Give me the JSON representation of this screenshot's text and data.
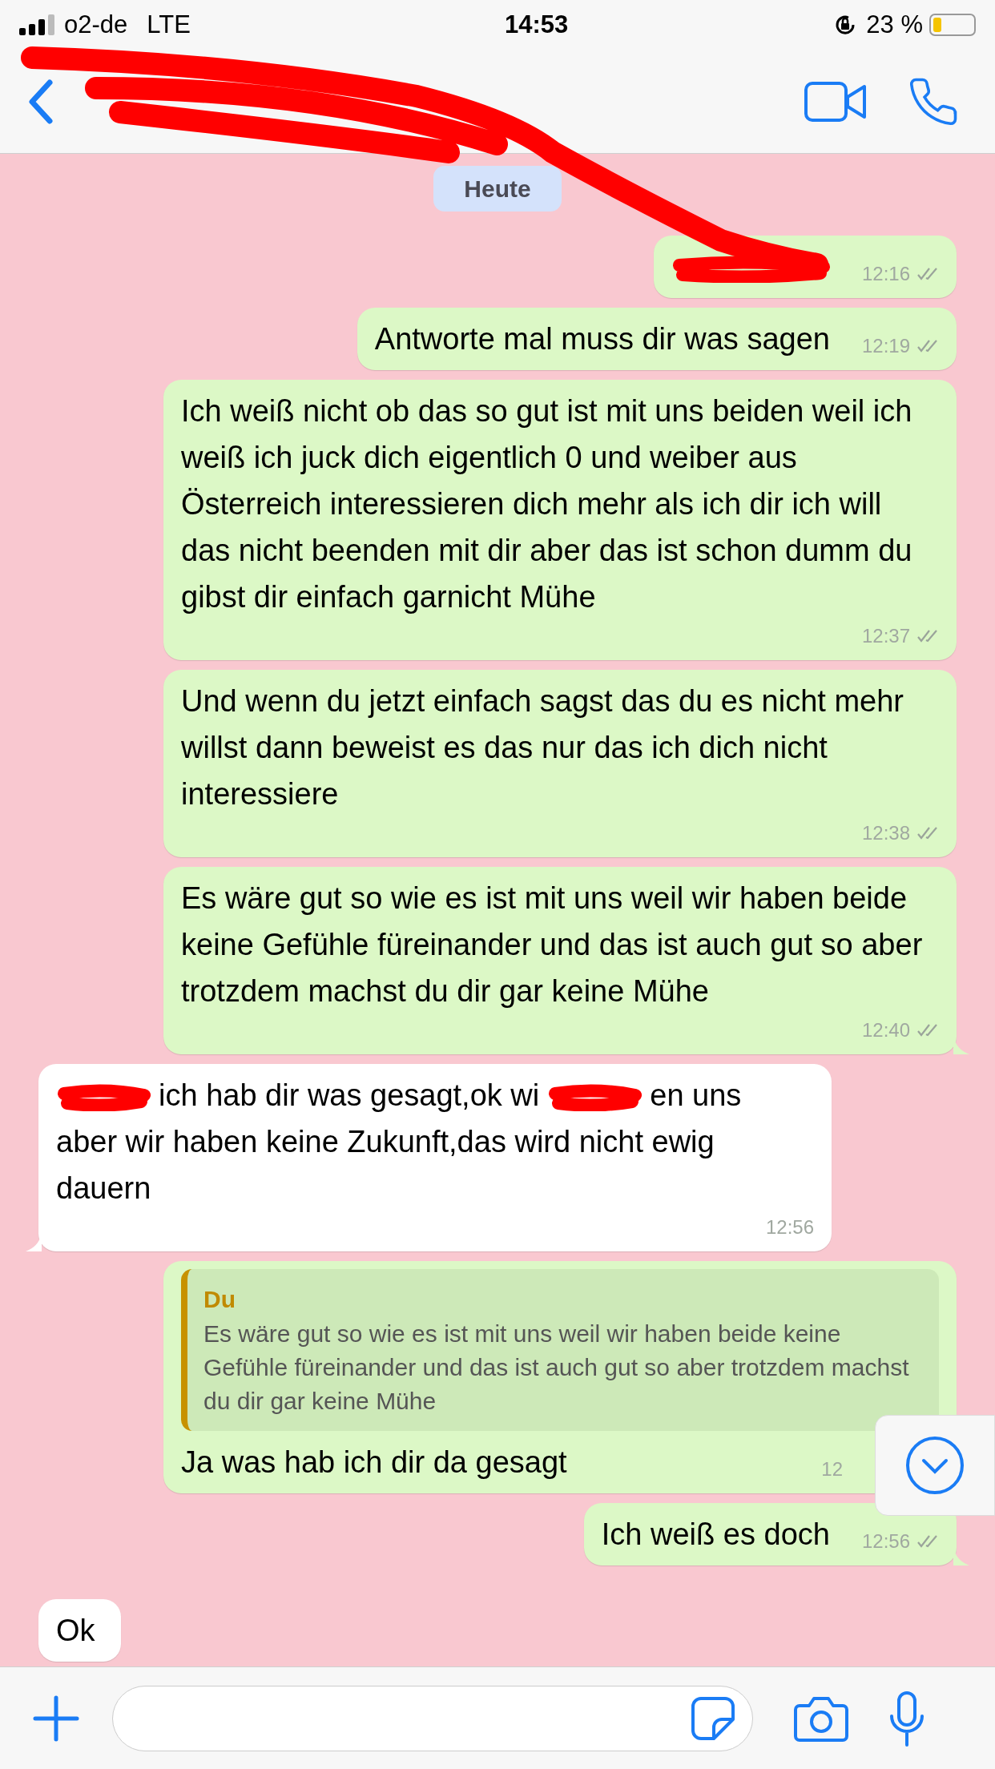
{
  "status_bar": {
    "carrier": "o2-de",
    "network": "LTE",
    "time": "14:53",
    "battery": "23 %"
  },
  "date_chip": "Heute",
  "messages": [
    {
      "kind": "outgoing",
      "parts": [
        {
          "kind": "redaction"
        }
      ],
      "time": "12:16",
      "ticks": true,
      "tail": false
    },
    {
      "kind": "outgoing",
      "parts": [
        {
          "kind": "text",
          "text": "Antworte mal muss dir was sagen"
        }
      ],
      "time": "12:19",
      "ticks": true,
      "tail": false
    },
    {
      "kind": "outgoing",
      "parts": [
        {
          "kind": "text",
          "text": "Ich weiß nicht ob das so gut ist mit uns beiden weil ich weiß ich juck dich eigentlich 0 und weiber aus Österreich interessieren dich mehr als ich dir ich will das nicht beenden mit dir aber das ist schon dumm du gibst dir einfach garnicht Mühe"
        }
      ],
      "time": "12:37",
      "ticks": true,
      "tail": false
    },
    {
      "kind": "outgoing",
      "parts": [
        {
          "kind": "text",
          "text": "Und wenn du jetzt einfach sagst das du es nicht mehr willst dann beweist es das nur das ich dich nicht interessiere"
        }
      ],
      "time": "12:38",
      "ticks": true,
      "tail": false
    },
    {
      "kind": "outgoing",
      "parts": [
        {
          "kind": "text",
          "text": "Es wäre gut so wie es ist mit uns weil wir haben beide keine Gefühle füreinander und das ist auch gut so aber trotzdem machst du dir gar keine Mühe"
        }
      ],
      "time": "12:40",
      "ticks": true,
      "tail": true
    },
    {
      "kind": "incoming",
      "parts": [
        {
          "kind": "redaction"
        },
        {
          "kind": "text",
          "text": "ich hab dir was gesagt,ok wi"
        },
        {
          "kind": "redaction"
        },
        {
          "kind": "text",
          "text": "en uns"
        },
        {
          "kind": "text",
          "text": "aber wir haben keine Zukunft,das wird nicht ewig dauern"
        }
      ],
      "time": "12:56",
      "ticks": false,
      "tail": true
    },
    {
      "kind": "outgoing",
      "quote": {
        "author": "Du",
        "text": "Es wäre gut so wie es ist mit uns weil wir haben beide keine Gefühle füreinander und das ist auch gut so aber trotzdem machst du dir gar keine Mühe"
      },
      "parts": [
        {
          "kind": "text",
          "text": "Ja was hab ich dir da gesagt"
        }
      ],
      "time": "12",
      "ticks": false,
      "scroll_button_over_time": true
    },
    {
      "kind": "outgoing",
      "parts": [
        {
          "kind": "text",
          "text": "Ich weiß es doch"
        }
      ],
      "time": "12:56",
      "ticks": true,
      "tail": true
    },
    {
      "kind": "incoming",
      "parts": [
        {
          "kind": "text",
          "text": "Ok"
        }
      ],
      "tail": false
    }
  ]
}
